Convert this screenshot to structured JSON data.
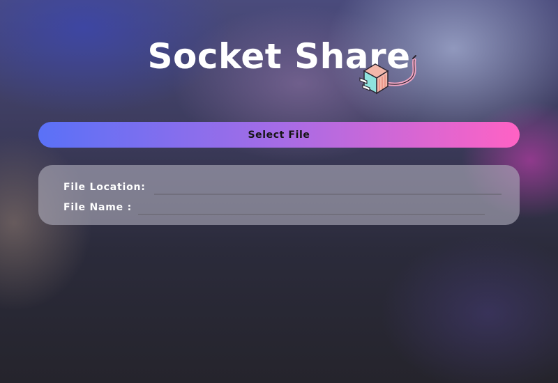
{
  "app": {
    "title": "Socket Share",
    "logo_icon": "plug-icon"
  },
  "actions": {
    "select_file_label": "Select File"
  },
  "file_info": {
    "location_label": "File Location:",
    "location_value": "",
    "name_label": "File Name :",
    "name_value": ""
  },
  "colors": {
    "button_gradient_start": "#5a71f7",
    "button_gradient_end": "#ff62c4",
    "panel": "#afacbc"
  }
}
